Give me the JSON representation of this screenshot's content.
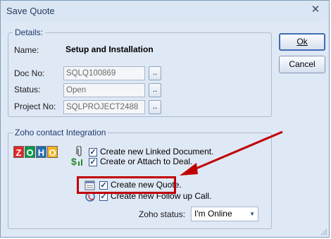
{
  "window": {
    "title": "Save Quote",
    "close_glyph": "✕"
  },
  "details": {
    "group_title": "Details:",
    "name_label": "Name:",
    "name_value": "Setup and Installation",
    "docno_label": "Doc No:",
    "docno_value": "SQLQ100869",
    "status_label": "Status:",
    "status_value": "Open",
    "project_label": "Project No:",
    "project_value": "SQLPROJECT2488",
    "browse_label": ".."
  },
  "buttons": {
    "ok": "Ok",
    "cancel": "Cancel"
  },
  "zoho": {
    "group_title": "Zoho contact Integration",
    "logo_letters": [
      "Z",
      "O",
      "H",
      "O"
    ],
    "logo_colors": [
      "#e42527",
      "#089949",
      "#226db4",
      "#f9b21d"
    ],
    "options": [
      {
        "label": "Create new Linked Document.",
        "checked": true,
        "icon": "paperclip-icon"
      },
      {
        "label": "Create or Attach to Deal.",
        "checked": true,
        "icon": "deal-dollar-icon"
      },
      {
        "label": "Create new Quote.",
        "checked": true,
        "icon": "quote-document-icon"
      },
      {
        "label": "Create new Follow up Call.",
        "checked": true,
        "icon": "phone-call-icon"
      }
    ],
    "status_label": "Zoho status:",
    "status_value": "I'm Online"
  },
  "annotation": {
    "arrow_color": "#c00000"
  }
}
